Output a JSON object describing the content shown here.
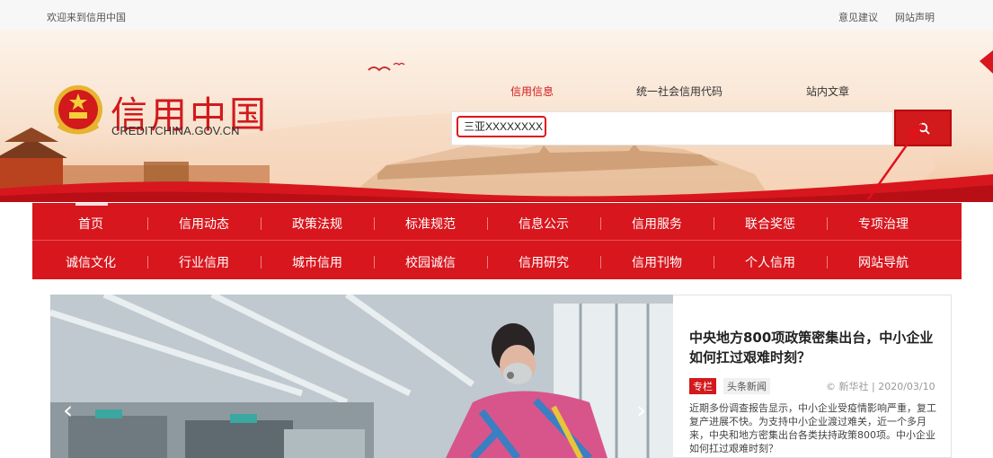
{
  "topbar": {
    "welcome": "欢迎来到信用中国",
    "links": [
      "意见建议",
      "网站声明"
    ]
  },
  "logo": {
    "chinese": "信用中国",
    "english": "CREDITCHINA.GOV.CN"
  },
  "search": {
    "tabs": [
      {
        "label": "信用信息",
        "active": true
      },
      {
        "label": "统一社会信用代码",
        "active": false
      },
      {
        "label": "站内文章",
        "active": false
      }
    ],
    "value": "三亚XXXXXXXX",
    "button_icon": "search-icon"
  },
  "nav": {
    "row1": [
      "首页",
      "信用动态",
      "政策法规",
      "标准规范",
      "信息公示",
      "信用服务",
      "联合奖惩",
      "专项治理"
    ],
    "row2": [
      "诚信文化",
      "行业信用",
      "城市信用",
      "校园诚信",
      "信用研究",
      "信用刊物",
      "个人信用",
      "网站导航"
    ],
    "active_index": 0
  },
  "hero": {
    "prev_icon": "chevron-left-icon",
    "next_icon": "chevron-right-icon"
  },
  "news": {
    "title": "中央地方800项政策密集出台，中小企业如何扛过艰难时刻？",
    "tag_column": "专栏",
    "tag_category": "头条新闻",
    "source": "© 新华社",
    "date": "2020/03/10",
    "summary": "近期多份调查报告显示，中小企业受疫情影响严重，复工复产进展不快。为支持中小企业渡过难关，近一个多月来，中央和地方密集出台各类扶持政策800项。中小企业如何扛过艰难时刻？"
  },
  "colors": {
    "brand_red": "#d8161d",
    "annotation_red": "#e0121b"
  }
}
